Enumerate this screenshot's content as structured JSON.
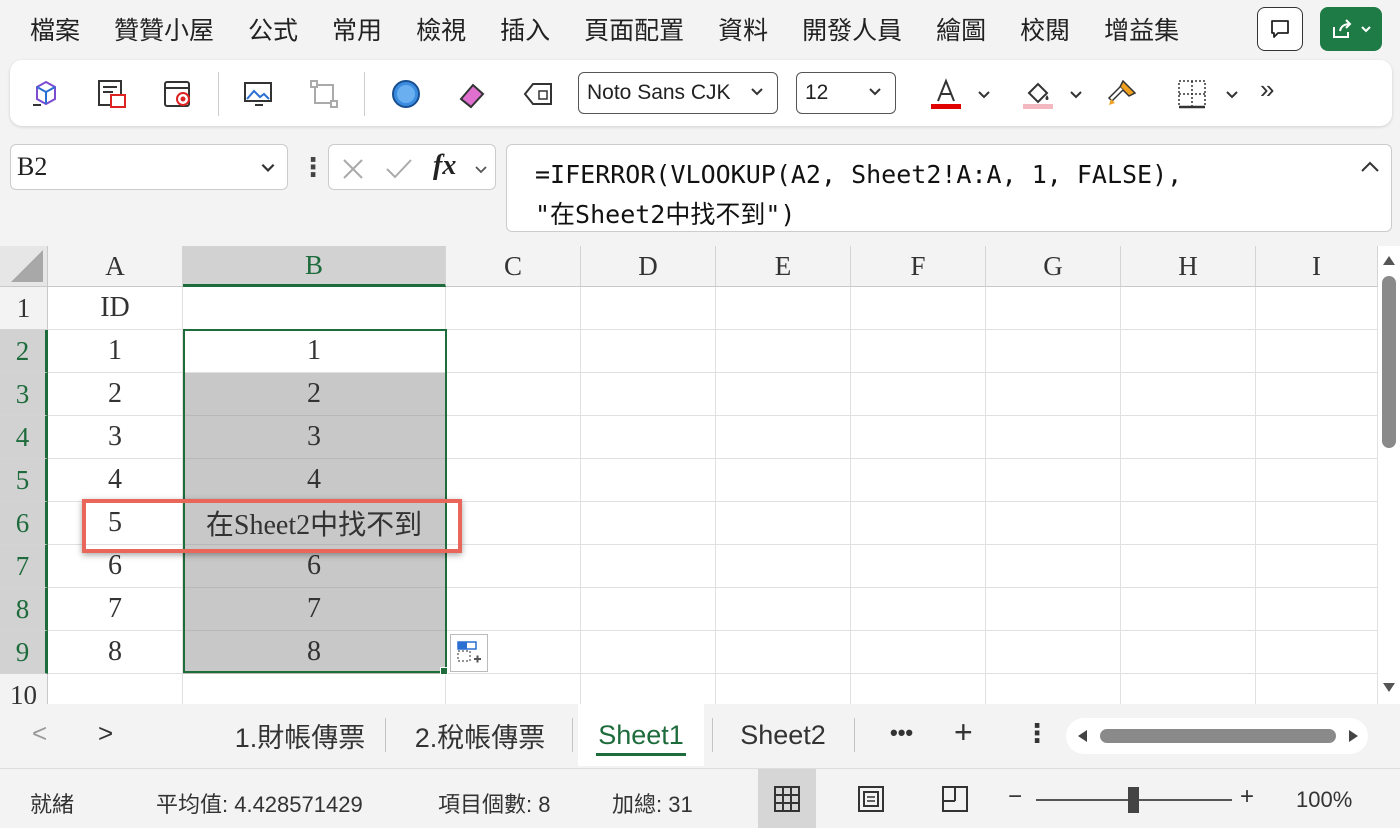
{
  "menubar": {
    "items": [
      "檔案",
      "贊贊小屋",
      "公式",
      "常用",
      "檢視",
      "插入",
      "頁面配置",
      "資料",
      "開發人員",
      "繪圖",
      "校閱",
      "增益集"
    ]
  },
  "ribbon": {
    "font_name": "Noto Sans CJK",
    "font_size": "12",
    "more": "»",
    "font_color_accent": "#e00000",
    "fill_color_accent": "#f4b8c0"
  },
  "formula_bar": {
    "name_box": "B2",
    "fx": "fx",
    "formula_line1": "=IFERROR(VLOOKUP(A2, Sheet2!A:A, 1, FALSE),",
    "formula_line2": "\"在Sheet2中找不到\")"
  },
  "grid": {
    "columns": [
      "A",
      "B",
      "C",
      "D",
      "E",
      "F",
      "G",
      "H",
      "I"
    ],
    "rows": [
      "1",
      "2",
      "3",
      "4",
      "5",
      "6",
      "7",
      "8",
      "9",
      "10"
    ],
    "colA": [
      "ID",
      "1",
      "2",
      "3",
      "4",
      "5",
      "6",
      "7",
      "8",
      ""
    ],
    "colB": [
      "",
      "1",
      "2",
      "3",
      "4",
      "在Sheet2中找不到",
      "6",
      "7",
      "8",
      ""
    ]
  },
  "tabs": {
    "prev": "<",
    "next": ">",
    "sheets": [
      "1.財帳傳票",
      "2.稅帳傳票",
      "Sheet1",
      "Sheet2"
    ],
    "active": "Sheet1",
    "more": "•••",
    "add": "+",
    "options": "⋮"
  },
  "statusbar": {
    "ready": "就緒",
    "average": "平均值: 4.428571429",
    "count": "項目個數: 8",
    "sum": "加總: 31",
    "zoom_minus": "−",
    "zoom_plus": "+",
    "zoom": "100%"
  },
  "colors": {
    "accent_green": "#1e6b3c",
    "highlight_red": "#e8675a",
    "share_green": "#1e7b45"
  }
}
